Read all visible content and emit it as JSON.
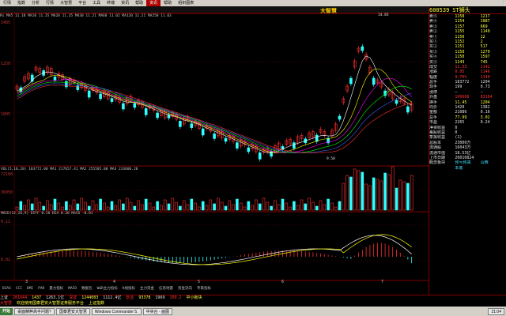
{
  "menu": [
    "行情",
    "指数",
    "分析",
    "行情",
    "大智慧",
    "平台",
    "工具",
    "终端",
    "资讯",
    "帮助",
    "资讯",
    "帮助",
    "组织图表"
  ],
  "window_controls": "_ □ X",
  "logo": "大智慧",
  "legend": {
    "ma": "Rs MA5 11.18 MA10 11.35 MA20 11.35 MA30 11.21 MA60 11.02 MA120 11.21 MA250 11.03",
    "vol": "VOL(5,10,20)  183772.00  MA1 217657.41  MA2 255505.00  MA3 233606.20",
    "macd": "MACD(12,26,9)  DIFF 0.28  DEA 0.30  MACD -0.01"
  },
  "y_labels": [
    "1485",
    "1250",
    "1005",
    "72108",
    "36050",
    "0.12",
    "0.02"
  ],
  "annotations": {
    "high": "14.85",
    "low": "9.58"
  },
  "x_ticks": [
    "3",
    "4",
    "5",
    "6",
    "7"
  ],
  "indicator_tabs": [
    "BIAS",
    "CCI",
    "DMI",
    "PAR",
    "量力指标",
    "MACD",
    "数据包",
    "W&R主力指标",
    "K线指标",
    "主力资金",
    "信息地雷",
    "资金流向",
    "专家指标"
  ],
  "right_panel": {
    "code": "600539",
    "name": "ST狮头",
    "rows": [
      {
        "l": "卖⑤",
        "v": "1158",
        "r": "1217",
        "c": "yel"
      },
      {
        "l": "卖④",
        "v": "1154",
        "r": "1087",
        "c": "yel"
      },
      {
        "l": "卖③",
        "v": "1157",
        "r": "669",
        "c": "yel"
      },
      {
        "l": "卖②",
        "v": "1155",
        "r": "1149",
        "c": "yel"
      },
      {
        "l": "卖①",
        "v": "1150",
        "r": "12",
        "c": "yel"
      },
      {
        "l": "买①",
        "v": "1152",
        "r": "2",
        "c": "yel"
      },
      {
        "l": "买②",
        "v": "1151",
        "r": "517",
        "c": "yel"
      },
      {
        "l": "买③",
        "v": "1150",
        "r": "1279",
        "c": "yel"
      },
      {
        "l": "买④",
        "v": "1150",
        "r": "1597",
        "c": "yel"
      },
      {
        "l": "买⑤",
        "v": "1143",
        "r": "745",
        "c": "yel"
      },
      {
        "l": "成交",
        "v": "11.53",
        "r": "1142",
        "c": "red"
      },
      {
        "l": "涨跌",
        "v": "0.05",
        "r": "1146",
        "c": "red"
      },
      {
        "l": "幅度",
        "v": "9.70%",
        "r": "1140",
        "c": "red"
      },
      {
        "l": "总手",
        "v": "183772",
        "r": "1204",
        "c": "wht"
      },
      {
        "l": "现手",
        "v": "199",
        "r": "0.73",
        "c": "wht"
      },
      {
        "l": "涨停",
        "v": "—",
        "r": "—",
        "c": "wht"
      },
      {
        "l": "外盘",
        "v": "100668",
        "r": "83104",
        "c": "red"
      },
      {
        "l": "换手",
        "v": "11.45",
        "r": "1204",
        "c": "yel"
      },
      {
        "l": "均价",
        "v": "1420",
        "r": "1382",
        "c": "wht"
      },
      {
        "l": "金额",
        "v": "21086",
        "r": "0.16",
        "c": "wht"
      },
      {
        "l": "总手",
        "v": "77.99",
        "r": "3.02",
        "c": "yel"
      },
      {
        "l": "市盈",
        "v": "2265",
        "r": "0.24",
        "c": "wht"
      },
      {
        "l": "净资收益",
        "v": "0",
        "r": "",
        "c": "wht"
      },
      {
        "l": "每股收益",
        "v": "0",
        "r": "",
        "c": "wht"
      },
      {
        "l": "季报收益",
        "v": "(1)",
        "r": "",
        "c": "wht"
      },
      {
        "l": "总股本",
        "v": "23000万",
        "r": "",
        "c": "wht"
      },
      {
        "l": "流通股",
        "v": "16043万",
        "r": "",
        "c": "wht"
      },
      {
        "l": "流通市值",
        "v": "18.53亿",
        "r": "",
        "c": "wht"
      },
      {
        "l": "上市日期",
        "v": "20010824",
        "r": "",
        "c": "wht"
      },
      {
        "l": "概念板块",
        "v": "预亏预减",
        "r": "山西",
        "c": "cyn"
      },
      {
        "l": "",
        "v": "本底",
        "r": "",
        "c": "cyn"
      }
    ]
  },
  "status": {
    "row1": [
      "上证",
      "281644",
      "1437",
      "1263.1亿",
      "深证",
      "1244083",
      "1112.4亿",
      "创业",
      "93378",
      "1969",
      "109.2",
      "中小板块"
    ],
    "row2": [
      "大智慧",
      "欢迎使用国泰君安大智慧证券服务平台",
      "上证指数"
    ]
  },
  "taskbar": {
    "start": "开始",
    "items": [
      "桌面精粹高手问题?",
      "国泰君安大智慧",
      "Windows Commander 5.",
      "中央台 - 画图"
    ],
    "clock": "21:04"
  }
}
